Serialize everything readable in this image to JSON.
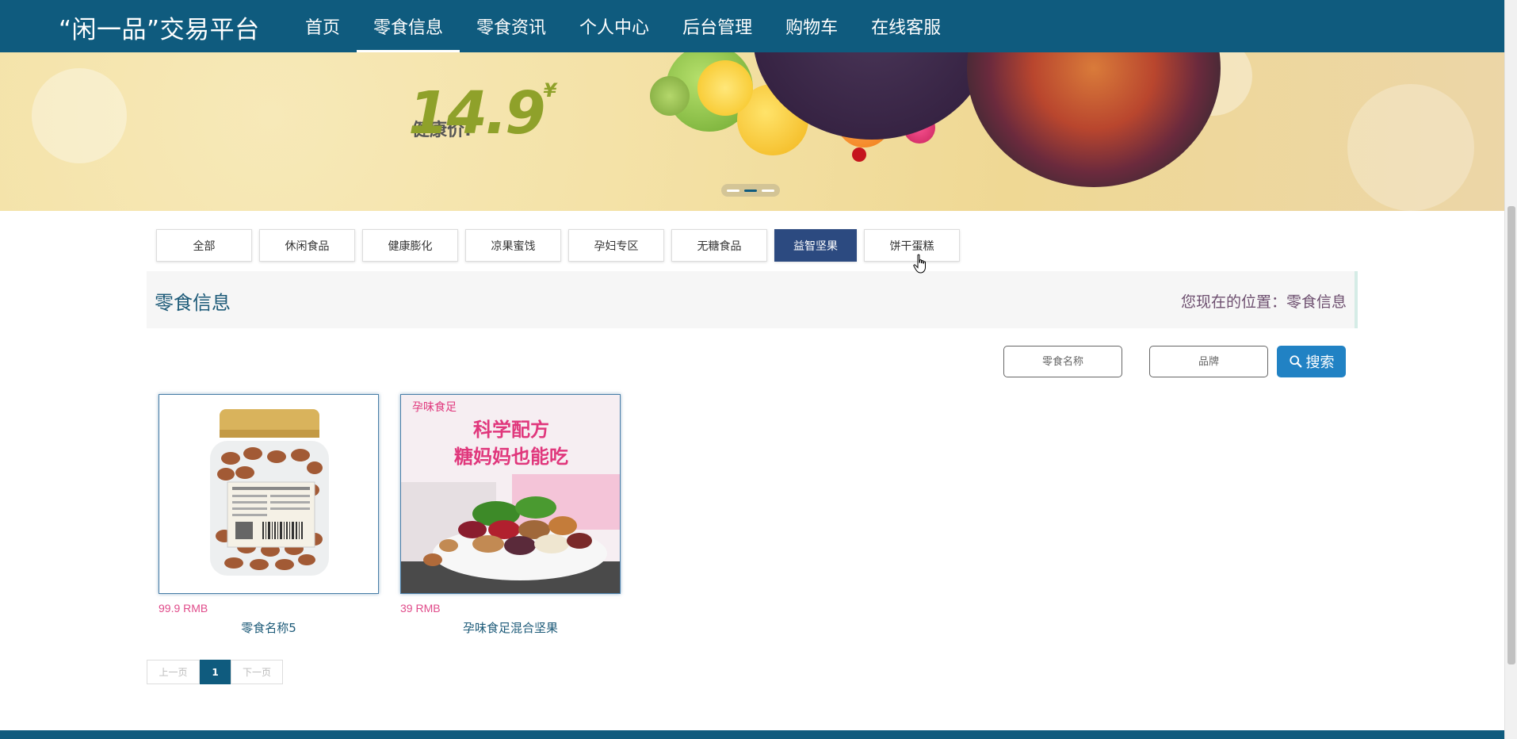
{
  "header": {
    "brand": "“闲一品”交易平台",
    "nav": [
      {
        "label": "首页",
        "active": false
      },
      {
        "label": "零食信息",
        "active": true
      },
      {
        "label": "零食资讯",
        "active": false
      },
      {
        "label": "个人中心",
        "active": false
      },
      {
        "label": "后台管理",
        "active": false
      },
      {
        "label": "购物车",
        "active": false
      },
      {
        "label": "在线客服",
        "active": false
      }
    ]
  },
  "banner": {
    "price_label": "健康价:",
    "price": "14.9",
    "currency": "¥",
    "slides": 3,
    "active_slide": 2
  },
  "categories": [
    {
      "label": "全部",
      "active": false
    },
    {
      "label": "休闲食品",
      "active": false
    },
    {
      "label": "健康膨化",
      "active": false
    },
    {
      "label": "凉果蜜饯",
      "active": false
    },
    {
      "label": "孕妇专区",
      "active": false
    },
    {
      "label": "无糖食品",
      "active": false
    },
    {
      "label": "益智坚果",
      "active": true
    },
    {
      "label": "饼干蛋糕",
      "active": false
    }
  ],
  "section": {
    "title": "零食信息",
    "location": "您现在的位置：零食信息"
  },
  "search": {
    "name_placeholder": "零食名称",
    "brand_placeholder": "品牌",
    "button_label": "搜索"
  },
  "products": [
    {
      "price": "99.9 RMB",
      "name": "零食名称5",
      "image": "almond-jar"
    },
    {
      "price": "39 RMB",
      "name": "孕味食足混合坚果",
      "image": "mixed-nuts",
      "image_text": {
        "brand": "孕味食足",
        "line1": "科学配方",
        "line2": "糖妈妈也能吃"
      }
    }
  ],
  "pagination": {
    "prev": "上一页",
    "current": "1",
    "next": "下一页"
  },
  "colors": {
    "nav_bg": "#0f5b7e",
    "active_category": "#2c4a80",
    "search_button": "#2182c4",
    "price": "#e04b8a"
  }
}
